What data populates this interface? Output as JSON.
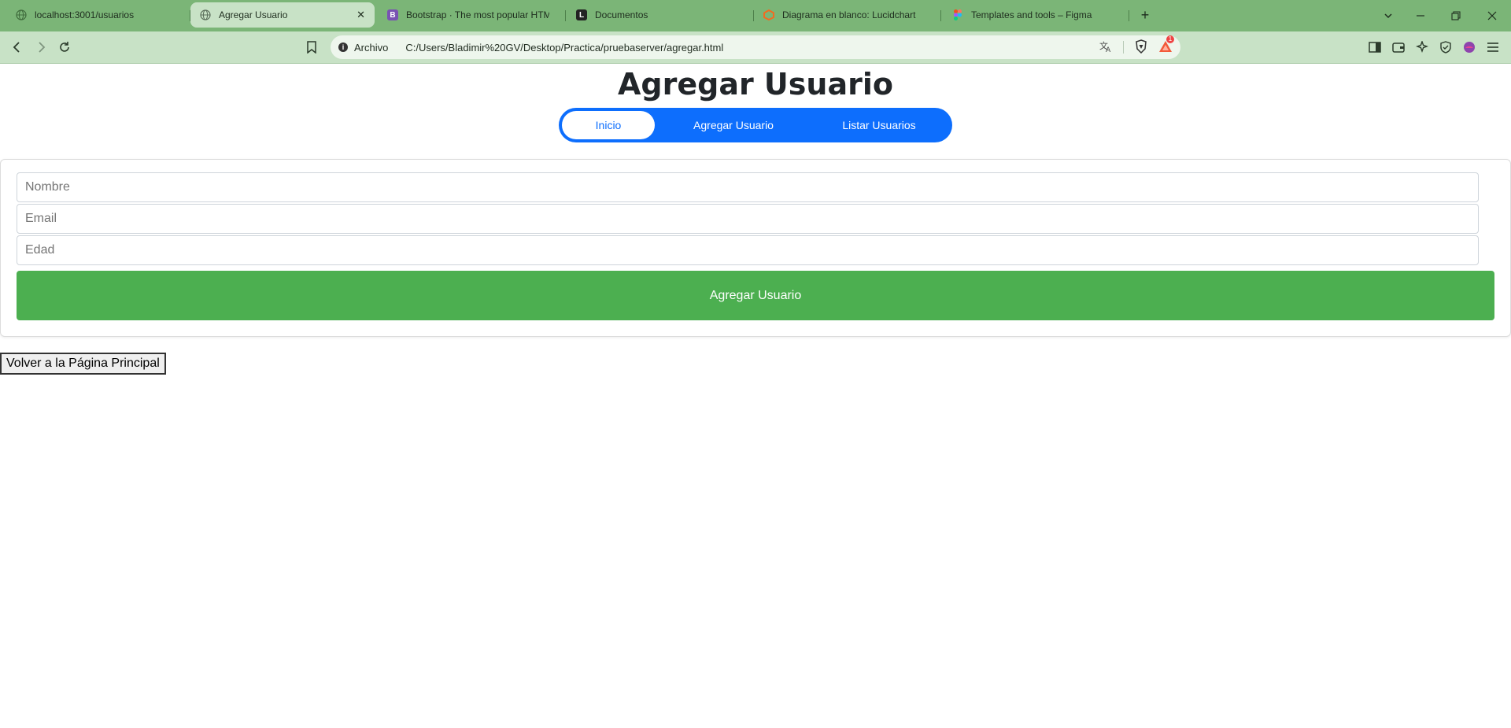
{
  "browser": {
    "tabs": [
      {
        "title": "localhost:3001/usuarios",
        "active": false
      },
      {
        "title": "Agregar Usuario",
        "active": true
      },
      {
        "title": "Bootstrap · The most popular HTML",
        "active": false
      },
      {
        "title": "Documentos",
        "active": false
      },
      {
        "title": "Diagrama en blanco: Lucidchart",
        "active": false
      },
      {
        "title": "Templates and tools – Figma",
        "active": false
      }
    ],
    "close_glyph": "✕",
    "new_tab_glyph": "+",
    "url_scheme": "Archivo",
    "url": "C:/Users/Bladimir%20GV/Desktop/Practica/pruebaserver/agregar.html",
    "notification_count": "1"
  },
  "page": {
    "title": "Agregar Usuario",
    "nav": {
      "home": "Inicio",
      "add": "Agregar Usuario",
      "list": "Listar Usuarios"
    },
    "form": {
      "name_placeholder": "Nombre",
      "email_placeholder": "Email",
      "age_placeholder": "Edad",
      "submit_label": "Agregar Usuario"
    },
    "back_label": "Volver a la Página Principal"
  },
  "colors": {
    "tabstrip": "#7bb577",
    "toolbar": "#c8e2c6",
    "nav_primary": "#0d6efd",
    "submit_green": "#4caf50"
  }
}
